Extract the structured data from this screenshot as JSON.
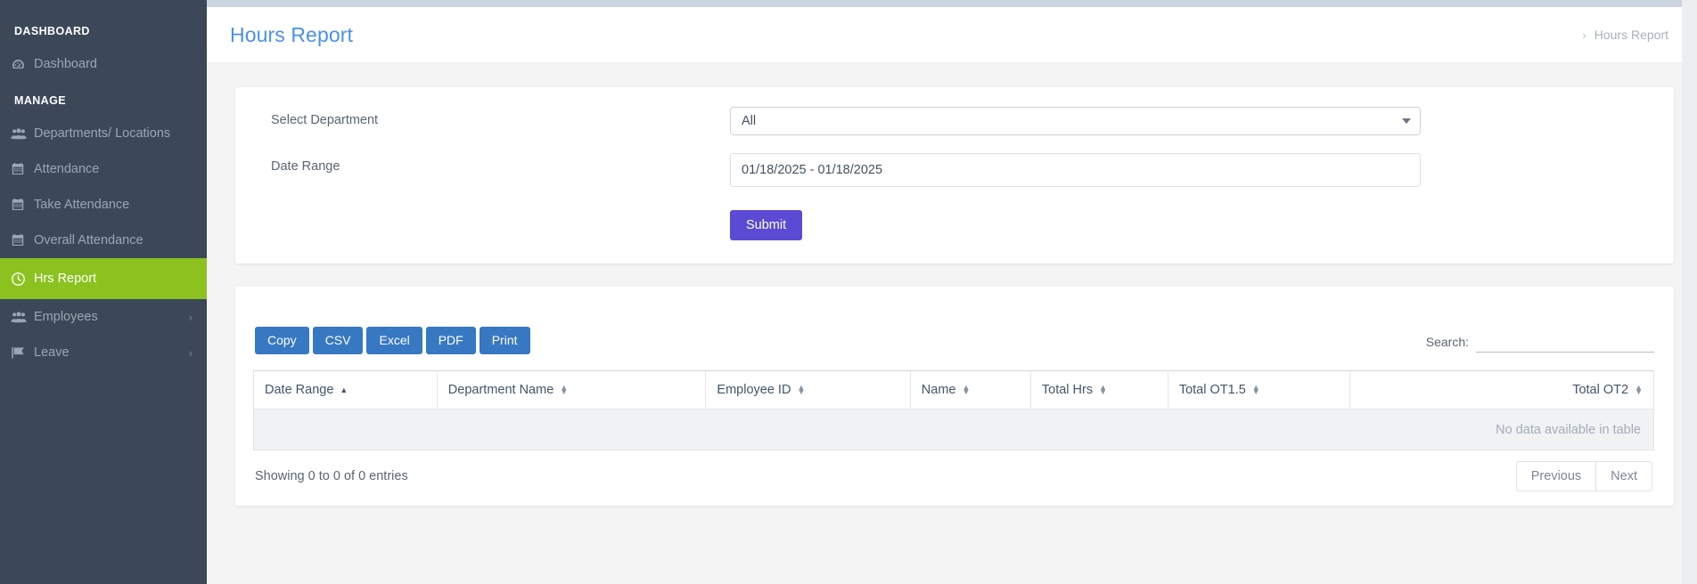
{
  "sidebar": {
    "sections": [
      {
        "title": "DASHBOARD",
        "items": [
          {
            "label": "Dashboard",
            "icon": "dashboard-gauge-icon",
            "active": false,
            "chevron": ""
          }
        ]
      },
      {
        "title": "MANAGE",
        "items": [
          {
            "label": "Departments/ Locations",
            "icon": "users-group-icon",
            "active": false,
            "chevron": ""
          },
          {
            "label": "Attendance",
            "icon": "calendar-icon",
            "active": false,
            "chevron": ""
          },
          {
            "label": "Take Attendance",
            "icon": "calendar-icon",
            "active": false,
            "chevron": ""
          },
          {
            "label": "Overall Attendance",
            "icon": "calendar-icon",
            "active": false,
            "chevron": ""
          },
          {
            "label": "Hrs Report",
            "icon": "clock-icon",
            "active": true,
            "chevron": ""
          },
          {
            "label": "Employees",
            "icon": "users-group-icon",
            "active": false,
            "chevron": "›"
          },
          {
            "label": "Leave",
            "icon": "flag-icon",
            "active": false,
            "chevron": "›"
          }
        ]
      }
    ],
    "active_color": "#8bc220",
    "background_color": "#3c4858"
  },
  "header": {
    "title": "Hours Report",
    "title_color": "#4a90e8",
    "breadcrumb_separator": "›",
    "breadcrumb_current": "Hours Report"
  },
  "form": {
    "department_label": "Select Department",
    "department_value": "All",
    "date_range_label": "Date Range",
    "date_range_value": "01/18/2025 - 01/18/2025",
    "submit_label": "Submit",
    "submit_color": "#5b4ad4"
  },
  "table_panel": {
    "export_buttons": [
      {
        "label": "Copy"
      },
      {
        "label": "CSV"
      },
      {
        "label": "Excel"
      },
      {
        "label": "PDF"
      },
      {
        "label": "Print"
      }
    ],
    "export_color": "#3778c2",
    "search_label": "Search:",
    "search_value": "",
    "search_placeholder": "",
    "columns": [
      {
        "label": "Date Range",
        "sort": "asc",
        "align": "left"
      },
      {
        "label": "Department Name",
        "sort": "both",
        "align": "left"
      },
      {
        "label": "Employee ID",
        "sort": "both",
        "align": "left"
      },
      {
        "label": "Name",
        "sort": "both",
        "align": "left"
      },
      {
        "label": "Total Hrs",
        "sort": "both",
        "align": "left"
      },
      {
        "label": "Total OT1.5",
        "sort": "both",
        "align": "left"
      },
      {
        "label": "Total OT2",
        "sort": "both",
        "align": "right"
      }
    ],
    "empty_message": "No data available in table",
    "info_text": "Showing 0 to 0 of 0 entries",
    "pagination": {
      "previous_label": "Previous",
      "next_label": "Next"
    }
  }
}
